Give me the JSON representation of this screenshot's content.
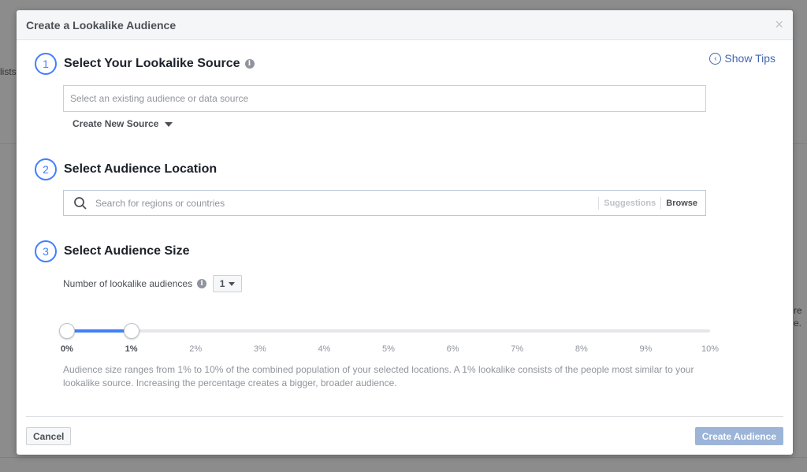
{
  "background": {
    "left_text": "lists",
    "right_text_1": "re",
    "right_text_2": "e."
  },
  "modal": {
    "title": "Create a Lookalike Audience",
    "close_glyph": "×",
    "show_tips": "Show Tips",
    "step1": {
      "number": "1",
      "title": "Select Your Lookalike Source",
      "placeholder": "Select an existing audience or data source",
      "create_new_source": "Create New Source"
    },
    "step2": {
      "number": "2",
      "title": "Select Audience Location",
      "placeholder": "Search for regions or countries",
      "suggestions": "Suggestions",
      "browse": "Browse"
    },
    "step3": {
      "number": "3",
      "title": "Select Audience Size",
      "number_label": "Number of lookalike audiences",
      "number_value": "1",
      "slider": {
        "min": 0,
        "max": 10,
        "selected_range": [
          0,
          1
        ],
        "ticks": [
          "0%",
          "1%",
          "2%",
          "3%",
          "4%",
          "5%",
          "6%",
          "7%",
          "8%",
          "9%",
          "10%"
        ],
        "accent": "#4080ff"
      },
      "description": "Audience size ranges from 1% to 10% of the combined population of your selected locations. A 1% lookalike consists of the people most similar to your lookalike source. Increasing the percentage creates a bigger, broader audience."
    },
    "footer": {
      "cancel": "Cancel",
      "create": "Create Audience"
    }
  },
  "icons": {
    "info": "info-icon",
    "search": "search-icon",
    "tips": "chevron-left-circle-icon"
  }
}
